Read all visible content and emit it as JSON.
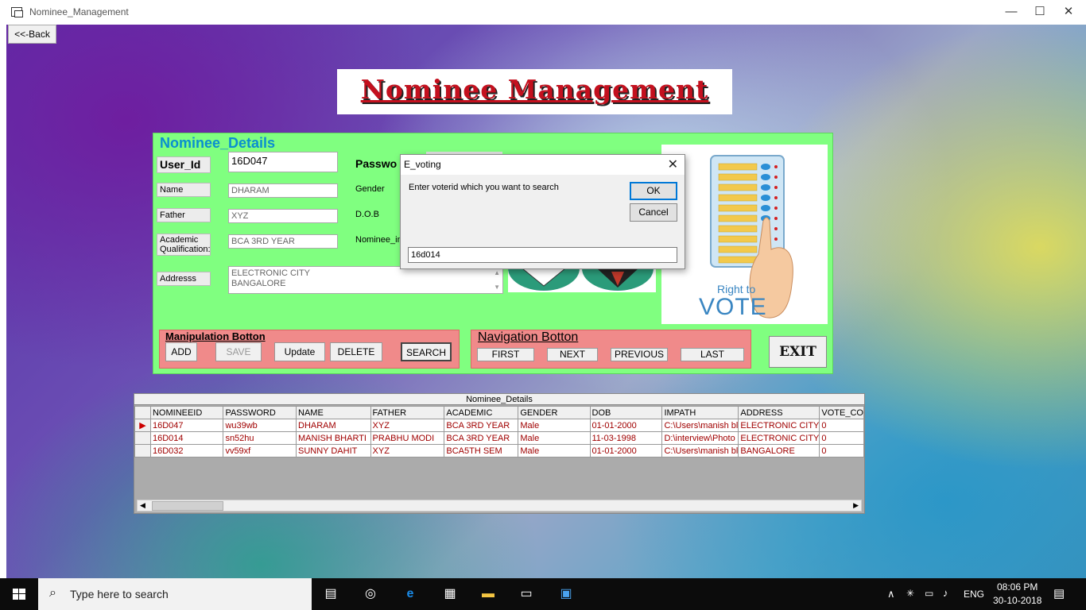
{
  "window": {
    "title": "Nominee_Management",
    "minimize": "—",
    "maximize": "☐",
    "close": "✕"
  },
  "back_label": "<<-Back",
  "banner": "Nominee Management",
  "panel_title": "Nominee_Details",
  "labels": {
    "user_id": "User_Id",
    "password": "Passwo",
    "name": "Name",
    "father": "Father",
    "academic": "Academic Qualification:",
    "address": "Addresss",
    "gender": "Gender",
    "dob": "D.O.B",
    "nominee_img": "Nominee_im"
  },
  "fields": {
    "user_id": "16D047",
    "name": "DHARAM",
    "father": "XYZ",
    "academic": "BCA 3RD YEAR",
    "address_line1": "ELECTRONIC CITY",
    "address_line2": "BANGALORE"
  },
  "manipulation": {
    "title": "Manipulation Botton",
    "add": "ADD",
    "save": "SAVE",
    "update": "Update",
    "delete": "DELETE",
    "search": "SEARCH"
  },
  "navigation": {
    "title": "Navigation Botton",
    "first": "FIRST",
    "next": "NEXT",
    "previous": "PREVIOUS",
    "last": "LAST"
  },
  "exit_label": "EXIT",
  "vote_image": {
    "text1": "Right to",
    "text2": "VOTE"
  },
  "dialog": {
    "title": "E_voting",
    "prompt": "Enter voterid which you want to search",
    "ok": "OK",
    "cancel": "Cancel",
    "input_value": "16d014"
  },
  "grid": {
    "caption": "Nominee_Details",
    "columns": [
      "NOMINEEID",
      "PASSWORD",
      "NAME",
      "FATHER",
      "ACADEMIC",
      "GENDER",
      "DOB",
      "IMPATH",
      "ADDRESS",
      "VOTE_CO"
    ],
    "rows": [
      [
        "16D047",
        "wu39wb",
        "DHARAM",
        "XYZ",
        "BCA 3RD YEAR",
        "Male",
        "01-01-2000",
        "C:\\Users\\manish bl",
        "ELECTRONIC CITY",
        "0"
      ],
      [
        "16D014",
        "sn52hu",
        "MANISH BHARTI",
        "PRABHU MODI",
        "BCA 3RD YEAR",
        "Male",
        "11-03-1998",
        "D:\\interview\\Photo",
        "ELECTRONIC CITY",
        "0"
      ],
      [
        "16D032",
        "vv59xf",
        "SUNNY DAHIT",
        "XYZ",
        "BCA5TH SEM",
        "Male",
        "01-01-2000",
        "C:\\Users\\manish bl",
        "BANGALORE",
        "0"
      ]
    ]
  },
  "taskbar": {
    "search_placeholder": "Type here to search",
    "lang": "ENG",
    "time": "08:06 PM",
    "date": "30-10-2018"
  }
}
